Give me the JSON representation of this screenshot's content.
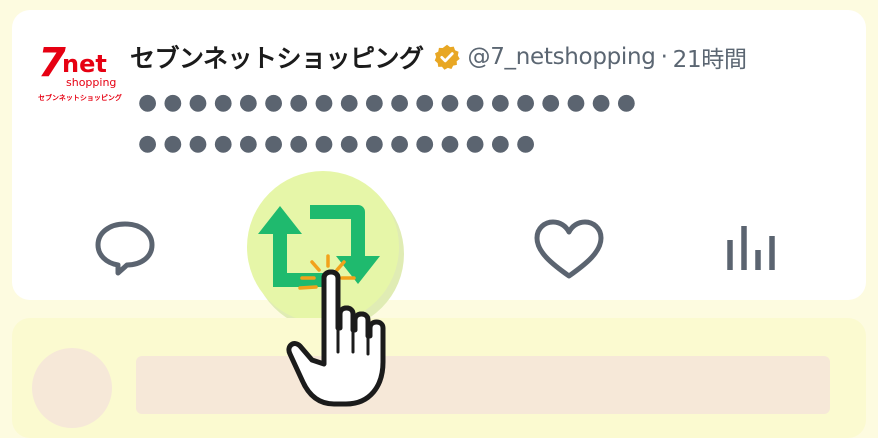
{
  "tweet": {
    "display_name": "セブンネットショッピング",
    "handle": "@7_netshopping",
    "separator": "·",
    "timestamp": "21時間",
    "body_line1": "●●●●●●●●●●●●●●●●●●●●",
    "body_line2": "●●●●●●●●●●●●●●●●"
  },
  "logo": {
    "brand_7": "7",
    "brand_net": "net",
    "brand_shopping": "shopping",
    "brand_kana": "セブンネットショッピング"
  },
  "actions": [
    {
      "name": "reply",
      "icon": "reply-icon"
    },
    {
      "name": "retweet",
      "icon": "retweet-icon",
      "highlighted": true
    },
    {
      "name": "like",
      "icon": "heart-icon"
    },
    {
      "name": "views",
      "icon": "analytics-icon"
    }
  ],
  "colors": {
    "background": "#fdfbe0",
    "card": "#ffffff",
    "retweet_green": "#1fba6e",
    "highlight_glow": "#e6f6a8",
    "icon_gray": "#5b6470",
    "verified_gold": "#e8a724",
    "brand_red": "#e60012"
  }
}
